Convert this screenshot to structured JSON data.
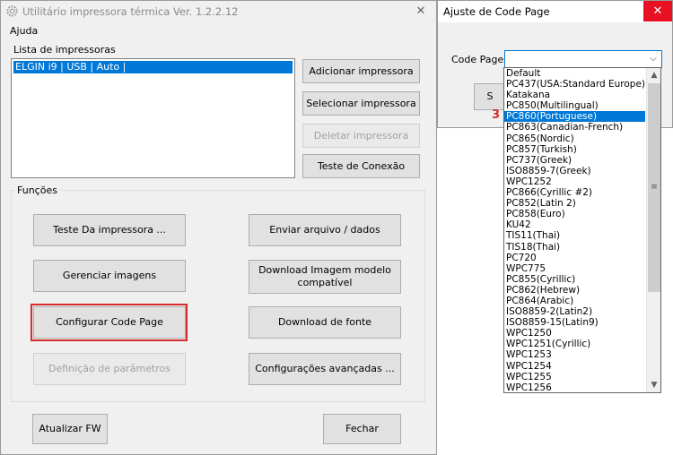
{
  "main_window": {
    "title": "Utilitário impressora térmica Ver. 1.2.2.12",
    "close_glyph": "✕",
    "menu": {
      "ajuda": "Ajuda"
    },
    "printers_label": "Lista de impressoras",
    "printers": [
      "ELGIN i9 | USB | Auto |"
    ],
    "buttons": {
      "add": "Adicionar impressora",
      "select": "Selecionar impressora",
      "delete": "Deletar impressora",
      "connection_test": "Teste de Conexão"
    },
    "functions_label": "Funções",
    "functions": {
      "test_printer": "Teste Da impressora ...",
      "send_file": "Enviar arquivo / dados",
      "manage_images": "Gerenciar imagens",
      "download_image": "Download Imagem modelo compatível",
      "config_codepage": "Configurar Code Page",
      "download_font": "Download de fonte",
      "param_definition": "Definição de parâmetros",
      "advanced_settings": "Configurações avançadas ..."
    },
    "update_fw": "Atualizar FW",
    "close": "Fechar"
  },
  "codepage_dialog": {
    "title": "Ajuste de Code Page",
    "close_glyph": "✕",
    "label": "Code Page:",
    "selected_value": "",
    "ok_button_partial": "S",
    "options": [
      "Default",
      "PC437(USA:Standard Europe)",
      "Katakana",
      "PC850(Multilingual)",
      "PC860(Portuguese)",
      "PC863(Canadian-French)",
      "PC865(Nordic)",
      "PC857(Turkish)",
      "PC737(Greek)",
      "ISO8859-7(Greek)",
      "WPC1252",
      "PC866(Cyrillic #2)",
      "PC852(Latin 2)",
      "PC858(Euro)",
      "KU42",
      "TIS11(Thai)",
      "TIS18(Thai)",
      "PC720",
      "WPC775",
      "PC855(Cyrillic)",
      "PC862(Hebrew)",
      "PC864(Arabic)",
      "ISO8859-2(Latin2)",
      "ISO8859-15(Latin9)",
      "WPC1250",
      "WPC1251(Cyrillic)",
      "WPC1253",
      "WPC1254",
      "WPC1255",
      "WPC1256"
    ],
    "highlighted_index": 4
  },
  "annotation": {
    "step": "3",
    "color": "#d62b2b"
  },
  "colors": {
    "selection": "#0078d7",
    "close_hover": "#e81123"
  }
}
